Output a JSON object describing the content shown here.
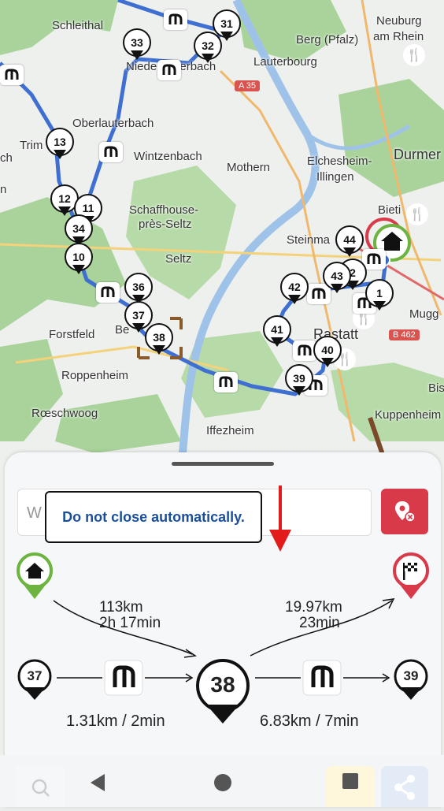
{
  "map": {
    "places": [
      {
        "id": "schleithal",
        "text": "Schleithal"
      },
      {
        "id": "neuburg",
        "text": "Neuburg"
      },
      {
        "id": "am_rhein",
        "text": "am Rhein"
      },
      {
        "id": "berg",
        "text": "Berg (Pfalz)"
      },
      {
        "id": "lauterbourg",
        "text": "Lauterbourg"
      },
      {
        "id": "nederbach",
        "text": "Niederlauterbach"
      },
      {
        "id": "oberlauterbach",
        "text": "Oberlauterbach"
      },
      {
        "id": "wintzenbach",
        "text": "Wintzenbach"
      },
      {
        "id": "trimbach",
        "text": "Trim"
      },
      {
        "id": "ch",
        "text": "ch"
      },
      {
        "id": "n",
        "text": "n"
      },
      {
        "id": "mothern",
        "text": "Mothern"
      },
      {
        "id": "elchesheim",
        "text": "Elchesheim-"
      },
      {
        "id": "illingen",
        "text": "Illingen"
      },
      {
        "id": "durmersheim",
        "text": "Durmer"
      },
      {
        "id": "bietigheim",
        "text": "Bieti"
      },
      {
        "id": "schaffhouse",
        "text": "Schaffhouse-"
      },
      {
        "id": "pres_seltz",
        "text": "près-Seltz"
      },
      {
        "id": "steinmauern",
        "text": "Steinma"
      },
      {
        "id": "seltz",
        "text": "Seltz"
      },
      {
        "id": "muggensturm",
        "text": "Mugg"
      },
      {
        "id": "forstfeld",
        "text": "Forstfeld"
      },
      {
        "id": "beinheim",
        "text": "Be"
      },
      {
        "id": "rastatt",
        "text": "Rastatt"
      },
      {
        "id": "roppenheim",
        "text": "Roppenheim"
      },
      {
        "id": "bis",
        "text": "Bis"
      },
      {
        "id": "roeschwoog",
        "text": "Rœschwoog"
      },
      {
        "id": "kuppenheim",
        "text": "Kuppenheim"
      },
      {
        "id": "iffezheim",
        "text": "Iffezheim"
      }
    ],
    "road_labels": [
      "A 35",
      "B 462"
    ],
    "waypoints": [
      "31",
      "33",
      "32",
      "13",
      "12",
      "11",
      "34",
      "10",
      "36",
      "37",
      "38",
      "44",
      "2",
      "43",
      "1",
      "42",
      "41",
      "40",
      "39"
    ],
    "colors": {
      "route": "#3f6fd1",
      "forest": "#a9d39b",
      "water": "#9fc3e8",
      "field": "#ececec"
    }
  },
  "sheet": {
    "search_placeholder": "W",
    "tooltip": "Do not close automatically.",
    "prev_leg": {
      "distance": "113km",
      "time": "2h 17min"
    },
    "next_leg": {
      "distance": "19.97km",
      "time": "23min"
    },
    "current_waypoint": "38",
    "prev_waypoint": "37",
    "next_waypoint": "39",
    "left_segment": "1.31km / 2min",
    "right_segment": "6.83km / 7min",
    "colors": {
      "home": "#6cb33f",
      "finish": "#d93a4a",
      "cancel": "#d93a4a",
      "tooltip_text": "#1b4f9c"
    }
  },
  "navbar": {
    "icons": [
      "search-icon",
      "back-icon",
      "home-circle-icon",
      "recents-icon",
      "share-icon"
    ]
  }
}
